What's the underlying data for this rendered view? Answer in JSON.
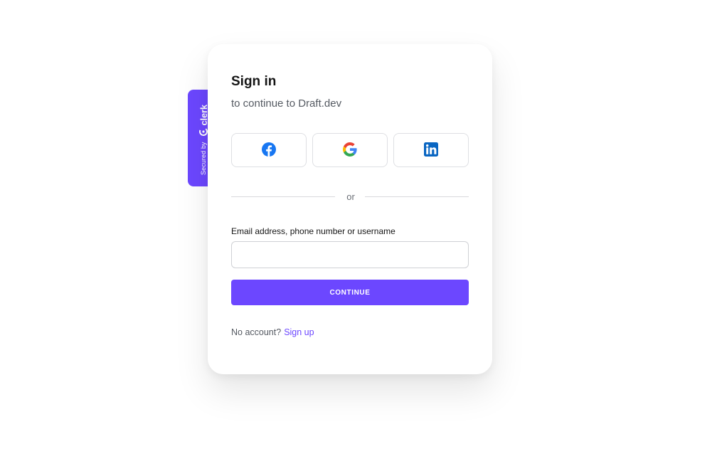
{
  "badge": {
    "secured_label": "Secured by",
    "brand": "clerk",
    "color": "#6c47ff"
  },
  "signin": {
    "title": "Sign in",
    "subtitle": "to continue to Draft.dev"
  },
  "social": [
    {
      "name": "Facebook",
      "icon": "facebook-icon",
      "color": "#1877f2"
    },
    {
      "name": "Google",
      "icon": "google-icon"
    },
    {
      "name": "LinkedIn",
      "icon": "linkedin-icon",
      "color": "#0a66c2"
    }
  ],
  "divider": {
    "text": "or"
  },
  "form": {
    "label": "Email address, phone number or username",
    "value": "",
    "placeholder": "",
    "submit_label": "CONTINUE"
  },
  "footer": {
    "prompt": "No account?",
    "link": "Sign up"
  },
  "colors": {
    "accent": "#6c47ff"
  }
}
